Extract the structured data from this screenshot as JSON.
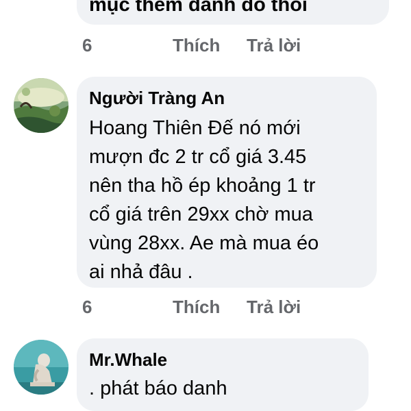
{
  "comments": [
    {
      "author": "",
      "text": "mục thêm danh đó thôi",
      "reactions": "6",
      "like_label": "Thích",
      "reply_label": "Trả lời"
    },
    {
      "author": "Người Tràng An",
      "text": "Hoang Thiên Đế  nó mới\nmượn đc 2 tr cổ giá 3.45\nnên tha hồ ép khoảng 1 tr\ncổ giá  trên 29xx chờ mua\nvùng 28xx. Ae mà mua éo\nai nhả đâu .",
      "reactions": "6",
      "like_label": "Thích",
      "reply_label": "Trả lời"
    },
    {
      "author": "Mr.Whale",
      "text": ". phát báo danh"
    }
  ],
  "avatars": [
    {
      "icon": "landscape-avatar-icon"
    },
    {
      "icon": "statue-avatar-icon"
    }
  ]
}
